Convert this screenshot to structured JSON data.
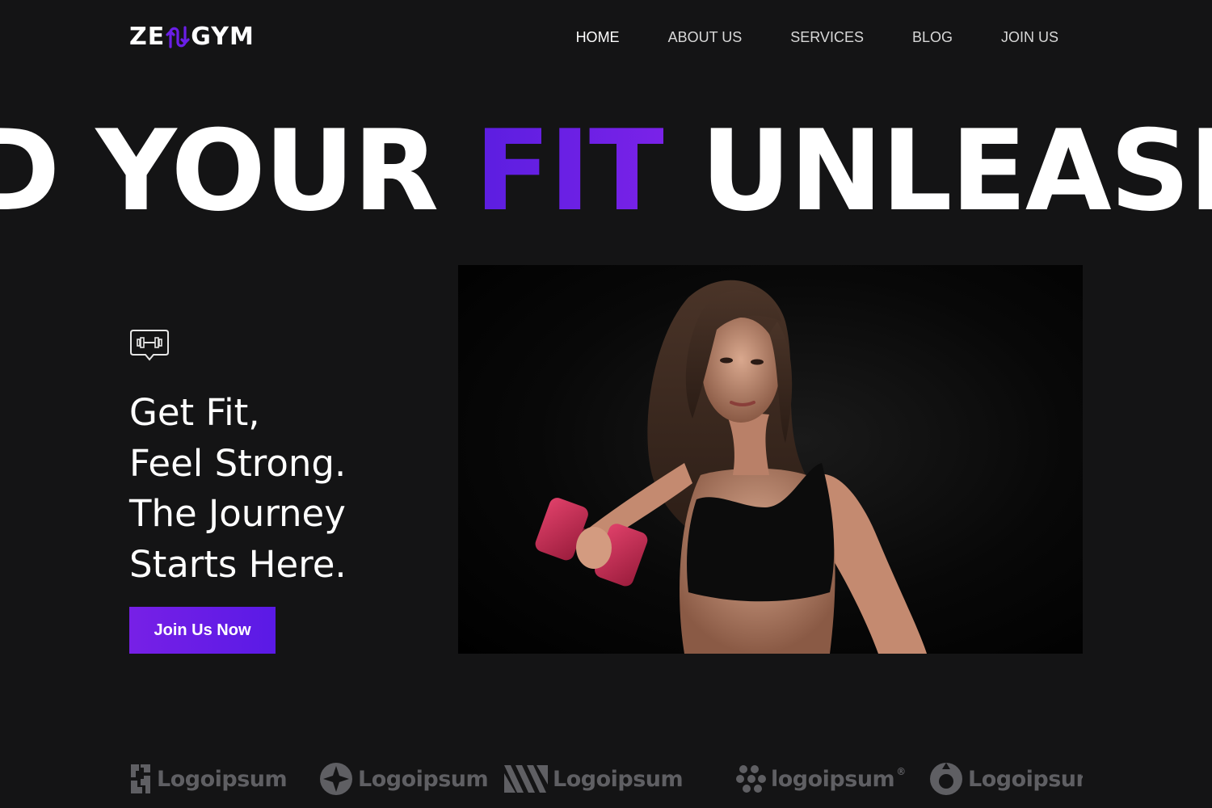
{
  "brand": {
    "name_prefix": "ZE",
    "name_suffix": "GYM",
    "accent_color": "#6a1fe6"
  },
  "nav": {
    "items": [
      {
        "label": "HOME",
        "active": true
      },
      {
        "label": "ABOUT US"
      },
      {
        "label": "SERVICES"
      },
      {
        "label": "BLOG"
      },
      {
        "label": "JOIN US"
      }
    ]
  },
  "marquee": {
    "before": "D YOUR ",
    "accent": "FIT",
    "after": " UNLEASH"
  },
  "hero": {
    "icon": "dumbbell-chat-icon",
    "heading_lines": [
      "Get Fit,",
      "Feel Strong.",
      "The Journey",
      "Starts Here."
    ],
    "cta_label": "Join Us Now",
    "image": "woman-with-red-dumbbell-photo"
  },
  "partners": {
    "logos": [
      {
        "label": "Logoipsum",
        "icon": "puzzle-logo-icon"
      },
      {
        "label": "Logoipsum",
        "icon": "star-circle-logo-icon"
      },
      {
        "label": "Logoipsum",
        "icon": "stripes-logo-icon"
      },
      {
        "label": "logoipsum",
        "icon": "dots-logo-icon",
        "mark": "®"
      },
      {
        "label": "Logoipsun",
        "icon": "ring-logo-icon"
      }
    ]
  }
}
